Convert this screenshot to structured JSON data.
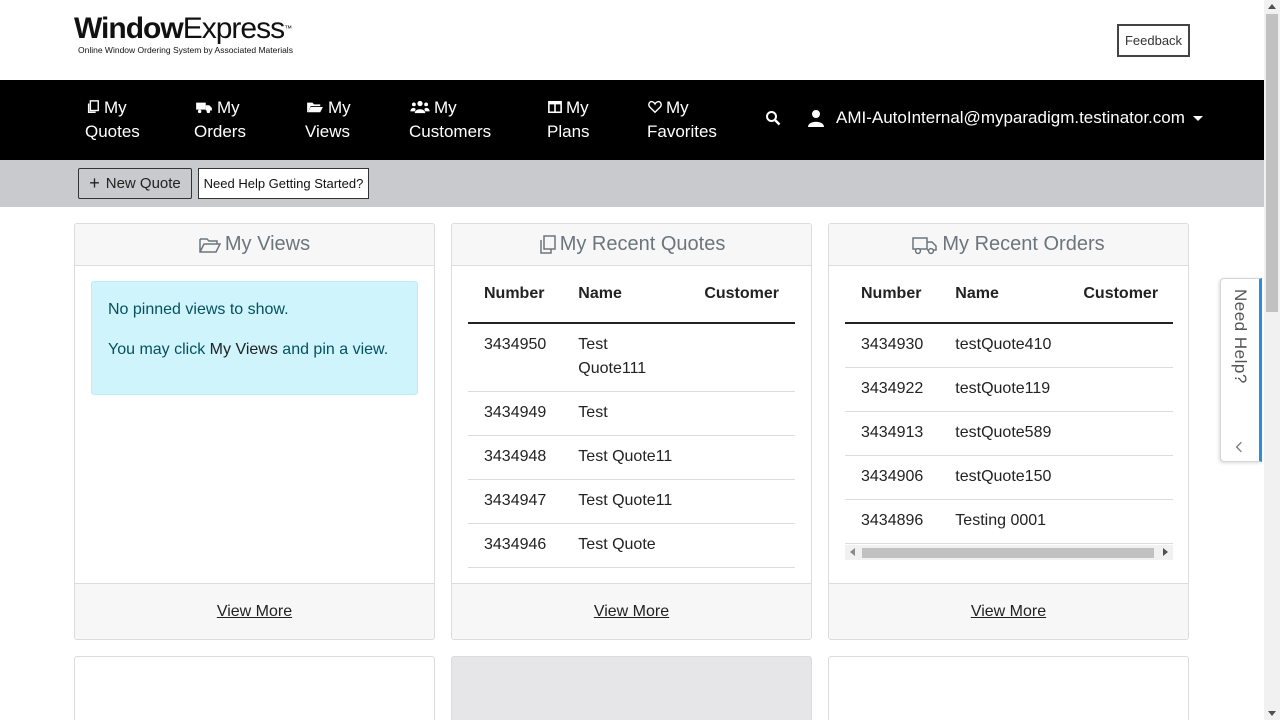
{
  "header": {
    "logo_bold": "Window",
    "logo_light": "Express",
    "logo_tm": "™",
    "logo_tagline": "Online Window Ordering System by Associated Materials",
    "feedback_label": "Feedback"
  },
  "nav": {
    "items": [
      {
        "line1": "My",
        "line2": "Quotes",
        "icon": "copy-icon"
      },
      {
        "line1": "My",
        "line2": "Orders",
        "icon": "truck-icon"
      },
      {
        "line1": "My",
        "line2": "Views",
        "icon": "folder-open-icon"
      },
      {
        "line1": "My",
        "line2": "Customers",
        "icon": "users-icon"
      },
      {
        "line1": "My",
        "line2": "Plans",
        "icon": "columns-icon"
      },
      {
        "line1": "My",
        "line2": "Favorites",
        "icon": "heart-icon"
      }
    ],
    "user_email": "AMI-AutoInternal@myparadigm.testinator.com"
  },
  "toolbar": {
    "new_quote_label": "New Quote",
    "help_label": "Need Help Getting Started?"
  },
  "my_views": {
    "title": "My Views",
    "empty_line1": "No pinned views to show.",
    "empty_line2_prefix": "You may click ",
    "empty_line2_link": "My Views",
    "empty_line2_suffix": " and pin a view.",
    "view_more": "View More"
  },
  "recent_quotes": {
    "title": "My Recent Quotes",
    "columns": [
      "Number",
      "Name",
      "Customer"
    ],
    "rows": [
      {
        "number": "3434950",
        "name_l1": "Test",
        "name_l2": "Quote111",
        "customer": ""
      },
      {
        "number": "3434949",
        "name_l1": "Test",
        "name_l2": "",
        "customer": ""
      },
      {
        "number": "3434948",
        "name_l1": "Test Quote11",
        "name_l2": "",
        "customer": ""
      },
      {
        "number": "3434947",
        "name_l1": "Test Quote11",
        "name_l2": "",
        "customer": ""
      },
      {
        "number": "3434946",
        "name_l1": "Test Quote",
        "name_l2": "",
        "customer": ""
      }
    ],
    "view_more": "View More"
  },
  "recent_orders": {
    "title": "My Recent Orders",
    "columns": [
      "Number",
      "Name",
      "Customer"
    ],
    "rows": [
      {
        "number": "3434930",
        "name": "testQuote410",
        "customer": ""
      },
      {
        "number": "3434922",
        "name": "testQuote119",
        "customer": ""
      },
      {
        "number": "3434913",
        "name": "testQuote589",
        "customer": ""
      },
      {
        "number": "3434906",
        "name": "testQuote150",
        "customer": ""
      },
      {
        "number": "3434896",
        "name": "Testing 0001",
        "customer": ""
      }
    ],
    "view_more": "View More"
  },
  "need_help_tab": {
    "label": "Need Help?"
  },
  "colors": {
    "nav_bg": "#000000",
    "subbar_bg": "#c8cacd",
    "info_bg": "#cff4fc",
    "info_text": "#055160",
    "need_help_accent": "#2a8fd6"
  }
}
